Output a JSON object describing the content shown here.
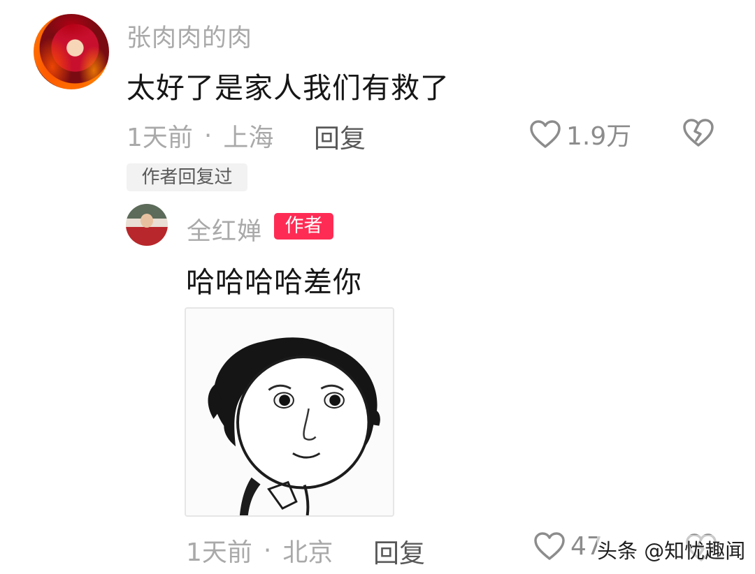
{
  "comment": {
    "username": "张肉肉的肉",
    "text": "太好了是家人我们有救了",
    "time": "1天前",
    "separator": "·",
    "location": "上海",
    "reply_label": "回复",
    "likes": "1.9万",
    "author_replied_tag": "作者回复过"
  },
  "reply": {
    "username": "全红婵",
    "badge": "作者",
    "text": "哈哈哈哈差你",
    "time": "1天前",
    "separator": "·",
    "location": "北京",
    "reply_label": "回复",
    "likes": "47"
  },
  "watermark": "头条 @知忧趣闻",
  "icons": {
    "like": "heart-outline-icon",
    "dislike": "broken-heart-icon"
  },
  "colors": {
    "badge_bg": "#fe2c55",
    "muted_text": "#a9a9a9"
  }
}
